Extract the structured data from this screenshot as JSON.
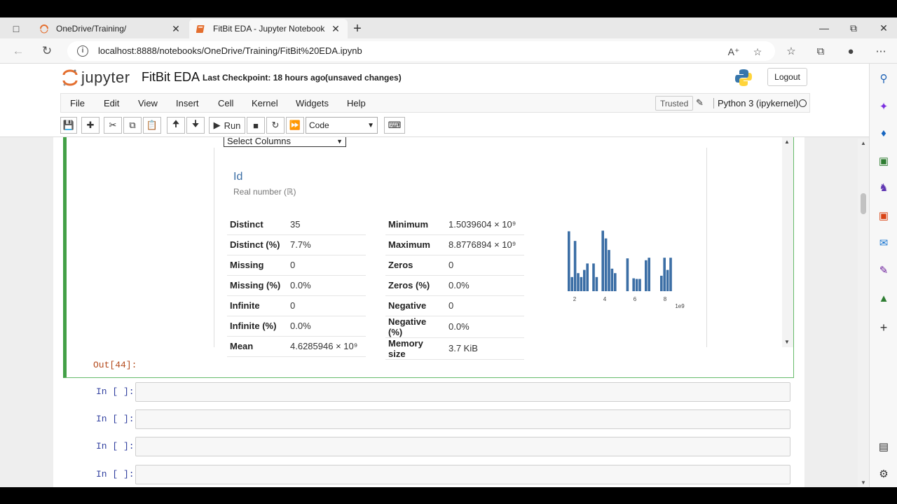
{
  "browser": {
    "tabs": [
      {
        "title": "OneDrive/Training/",
        "active": false
      },
      {
        "title": "FitBit EDA - Jupyter Notebook",
        "active": true
      }
    ],
    "new_tab": "+",
    "url": "localhost:8888/notebooks/OneDrive/Training/FitBit%20EDA.ipynb"
  },
  "jupyter": {
    "logo_word": "jupyter",
    "notebook_name": "FitBit EDA",
    "checkpoint_label": "Last Checkpoint:",
    "checkpoint_time": "18 hours ago",
    "unsaved": "(unsaved changes)",
    "logout": "Logout",
    "menu": [
      "File",
      "Edit",
      "View",
      "Insert",
      "Cell",
      "Kernel",
      "Widgets",
      "Help"
    ],
    "trusted": "Trusted",
    "kernel": "Python 3 (ipykernel)",
    "toolbar": {
      "run_label": "Run",
      "cell_type": "Code"
    }
  },
  "output": {
    "select_columns": "Select Columns",
    "variable": {
      "name": "Id",
      "type": "Real number (ℝ)"
    },
    "stats_left": [
      {
        "k": "Distinct",
        "v": "35"
      },
      {
        "k": "Distinct (%)",
        "v": "7.7%"
      },
      {
        "k": "Missing",
        "v": "0"
      },
      {
        "k": "Missing (%)",
        "v": "0.0%"
      },
      {
        "k": "Infinite",
        "v": "0"
      },
      {
        "k": "Infinite (%)",
        "v": "0.0%"
      },
      {
        "k": "Mean",
        "v": "4.6285946 × 10⁹"
      }
    ],
    "stats_right": [
      {
        "k": "Minimum",
        "v": "1.5039604 × 10⁹"
      },
      {
        "k": "Maximum",
        "v": "8.8776894 × 10⁹"
      },
      {
        "k": "Zeros",
        "v": "0"
      },
      {
        "k": "Zeros (%)",
        "v": "0.0%"
      },
      {
        "k": "Negative",
        "v": "0"
      },
      {
        "k": "Negative (%)",
        "v": "0.0%"
      },
      {
        "k": "Memory size",
        "v": "3.7 KiB"
      }
    ],
    "histogram": {
      "tick_labels": [
        "2",
        "4",
        "6",
        "8"
      ],
      "multiplier": "1e9",
      "color": "#3b6ea5",
      "bar_heights": [
        0.93,
        0.22,
        0.78,
        0.28,
        0.22,
        0.33,
        0.43,
        0.0,
        0.43,
        0.22,
        0.0,
        0.94,
        0.82,
        0.64,
        0.35,
        0.28,
        0.0,
        0.0,
        0.0,
        0.51,
        0.0,
        0.2,
        0.19,
        0.19,
        0.0,
        0.48,
        0.52,
        0.0,
        0.0,
        0.0,
        0.24,
        0.52,
        0.33,
        0.52
      ]
    },
    "out_prompt": "Out[44]:"
  },
  "empty_cells": [
    "In [ ]:",
    "In [ ]:",
    "In [ ]:",
    "In [ ]:"
  ]
}
